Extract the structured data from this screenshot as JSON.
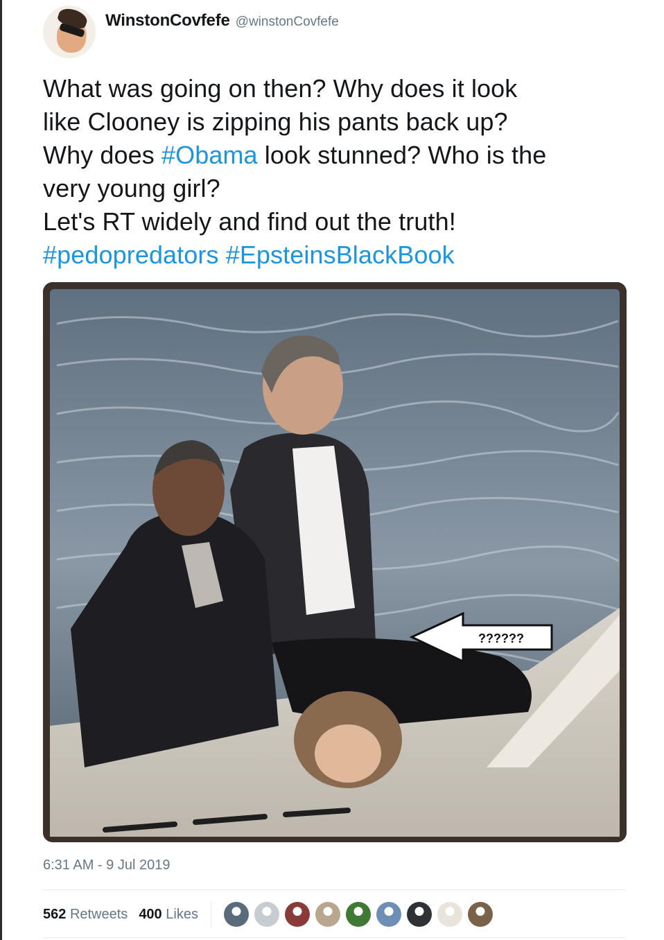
{
  "user": {
    "display_name": "WinstonCovfefe",
    "handle": "@winstonCovfefe",
    "avatar_icon": "avatar-photo"
  },
  "tweet": {
    "lines": [
      [
        {
          "text": "What was going on then? Why does it look",
          "type": "text"
        }
      ],
      [
        {
          "text": "like Clooney is zipping his pants back up?",
          "type": "text"
        }
      ],
      [
        {
          "text": "Why does ",
          "type": "text"
        },
        {
          "text": "#Obama",
          "type": "hashtag"
        },
        {
          "text": " look stunned? Who is the",
          "type": "text"
        }
      ],
      [
        {
          "text": "very young girl?",
          "type": "text"
        }
      ],
      [
        {
          "text": "Let's RT widely and find out the truth!",
          "type": "text"
        }
      ],
      [
        {
          "text": "#pedopredators",
          "type": "hashtag"
        },
        {
          "text": " ",
          "type": "text"
        },
        {
          "text": "#EpsteinsBlackBook",
          "type": "hashtag"
        }
      ]
    ],
    "hashtag_color": "#1b95e0"
  },
  "media": {
    "arrow_label": "??????"
  },
  "timestamp": "6:31 AM - 9 Jul 2019",
  "stats": {
    "retweets_count": "562",
    "retweets_label": "Retweets",
    "likes_count": "400",
    "likes_label": "Likes"
  },
  "likers": [
    {
      "name": "liker-avatar-1",
      "color": "#5a6b7c"
    },
    {
      "name": "liker-avatar-2",
      "color": "#c7ccd1"
    },
    {
      "name": "liker-avatar-3",
      "color": "#8b3a3a"
    },
    {
      "name": "liker-avatar-4",
      "color": "#b8a68e"
    },
    {
      "name": "liker-avatar-5",
      "color": "#3f7a34"
    },
    {
      "name": "liker-avatar-6",
      "color": "#6e8fb5"
    },
    {
      "name": "liker-avatar-7",
      "color": "#2e3236"
    },
    {
      "name": "liker-avatar-8",
      "color": "#e8e4dc"
    },
    {
      "name": "liker-avatar-9",
      "color": "#7a6248"
    }
  ]
}
